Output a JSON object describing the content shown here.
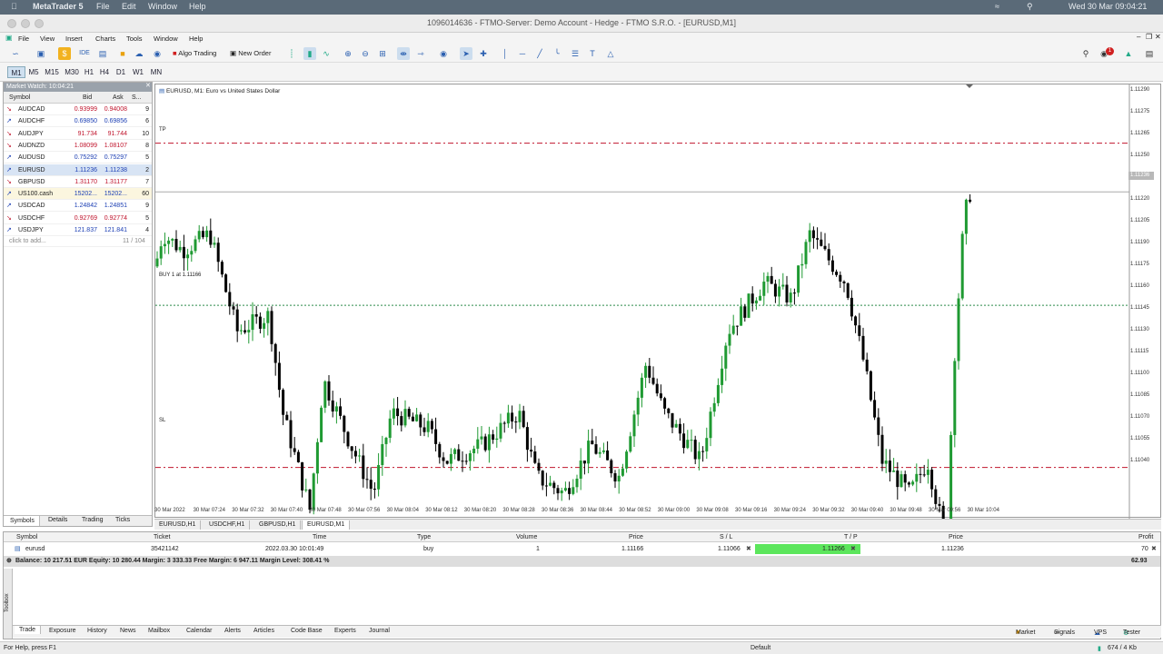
{
  "mac": {
    "app": "MetaTrader 5",
    "menus": [
      "File",
      "Edit",
      "Window",
      "Help"
    ],
    "clock": "Wed 30 Mar  09:04:21"
  },
  "window": {
    "title": "1096014636 - FTMO-Server: Demo Account - Hedge - FTMO S.R.O. - [EURUSD,M1]"
  },
  "menu": [
    "File",
    "View",
    "Insert",
    "Charts",
    "Tools",
    "Window",
    "Help"
  ],
  "toolbar": {
    "algo": "Algo Trading",
    "neworder": "New Order",
    "alerts_badge": "1"
  },
  "timeframes": [
    "M1",
    "M5",
    "M15",
    "M30",
    "H1",
    "H4",
    "D1",
    "W1",
    "MN"
  ],
  "marketwatch": {
    "title": "Market Watch: 10:04:21",
    "headers": [
      "Symbol",
      "Bid",
      "Ask",
      "S..."
    ],
    "rows": [
      {
        "sym": "AUDCAD",
        "bid": "0.93999",
        "ask": "0.94008",
        "s": "9"
      },
      {
        "sym": "AUDCHF",
        "bid": "0.69850",
        "ask": "0.69856",
        "s": "6"
      },
      {
        "sym": "AUDJPY",
        "bid": "91.734",
        "ask": "91.744",
        "s": "10"
      },
      {
        "sym": "AUDNZD",
        "bid": "1.08099",
        "ask": "1.08107",
        "s": "8"
      },
      {
        "sym": "AUDUSD",
        "bid": "0.75292",
        "ask": "0.75297",
        "s": "5"
      },
      {
        "sym": "EURUSD",
        "bid": "1.11236",
        "ask": "1.11238",
        "s": "2"
      },
      {
        "sym": "GBPUSD",
        "bid": "1.31170",
        "ask": "1.31177",
        "s": "7"
      },
      {
        "sym": "US100.cash",
        "bid": "15202...",
        "ask": "15202...",
        "s": "60"
      },
      {
        "sym": "USDCAD",
        "bid": "1.24842",
        "ask": "1.24851",
        "s": "9"
      },
      {
        "sym": "USDCHF",
        "bid": "0.92769",
        "ask": "0.92774",
        "s": "5"
      },
      {
        "sym": "USDJPY",
        "bid": "121.837",
        "ask": "121.841",
        "s": "4"
      }
    ],
    "add": "click to add...",
    "count": "11 / 104",
    "tabs": [
      "Symbols",
      "Details",
      "Trading",
      "Ticks"
    ]
  },
  "chart": {
    "label": "EURUSD, M1:  Euro vs United States Dollar",
    "tp": "TP",
    "sl": "SL",
    "buy": "BUY 1 at 1.11166",
    "current": "1.11236",
    "yticks": [
      "1.11290",
      "1.11275",
      "1.11265",
      "1.11250",
      "1.11236",
      "1.11220",
      "1.11205",
      "1.11190",
      "1.11175",
      "1.11160",
      "1.11145",
      "1.11130",
      "1.11115",
      "1.11100",
      "1.11085",
      "1.11070",
      "1.11055",
      "1.11040"
    ],
    "xticks": [
      "30 Mar 2022",
      "30 Mar 07:24",
      "30 Mar 07:32",
      "30 Mar 07:40",
      "30 Mar 07:48",
      "30 Mar 07:56",
      "30 Mar 08:04",
      "30 Mar 08:12",
      "30 Mar 08:20",
      "30 Mar 08:28",
      "30 Mar 08:36",
      "30 Mar 08:44",
      "30 Mar 08:52",
      "30 Mar 09:00",
      "30 Mar 09:08",
      "30 Mar 09:16",
      "30 Mar 09:24",
      "30 Mar 09:32",
      "30 Mar 09:40",
      "30 Mar 09:48",
      "30 Mar 09:56",
      "30 Mar 10:04"
    ],
    "tabs": [
      "EURUSD,H1",
      "USDCHF,H1",
      "GBPUSD,H1",
      "EURUSD,M1"
    ]
  },
  "trade": {
    "headers": [
      "Symbol",
      "Ticket",
      "Time",
      "Type",
      "Volume",
      "Price",
      "S / L",
      "T / P",
      "Price",
      "Profit"
    ],
    "row": {
      "symbol": "eurusd",
      "ticket": "35421142",
      "time": "2022.03.30 10:01:49",
      "type": "buy",
      "volume": "1",
      "price": "1.11166",
      "sl": "1.11066",
      "tp": "1.11266",
      "cur": "1.11236",
      "profit": "70"
    },
    "balance": "Balance: 10 217.51 EUR  Equity: 10 280.44  Margin: 3 333.33  Free Margin: 6 947.11  Margin Level: 308.41 %",
    "total": "62.93"
  },
  "toolbox": {
    "tabs": [
      "Trade",
      "Exposure",
      "History",
      "News",
      "Mailbox",
      "Calendar",
      "Alerts",
      "Articles",
      "Code Base",
      "Experts",
      "Journal"
    ],
    "right": [
      "Market",
      "Signals",
      "VPS",
      "Tester"
    ],
    "side": "Toolbox"
  },
  "status": {
    "help": "For Help, press F1",
    "profile": "Default",
    "traffic": "674 / 4 Kb"
  }
}
